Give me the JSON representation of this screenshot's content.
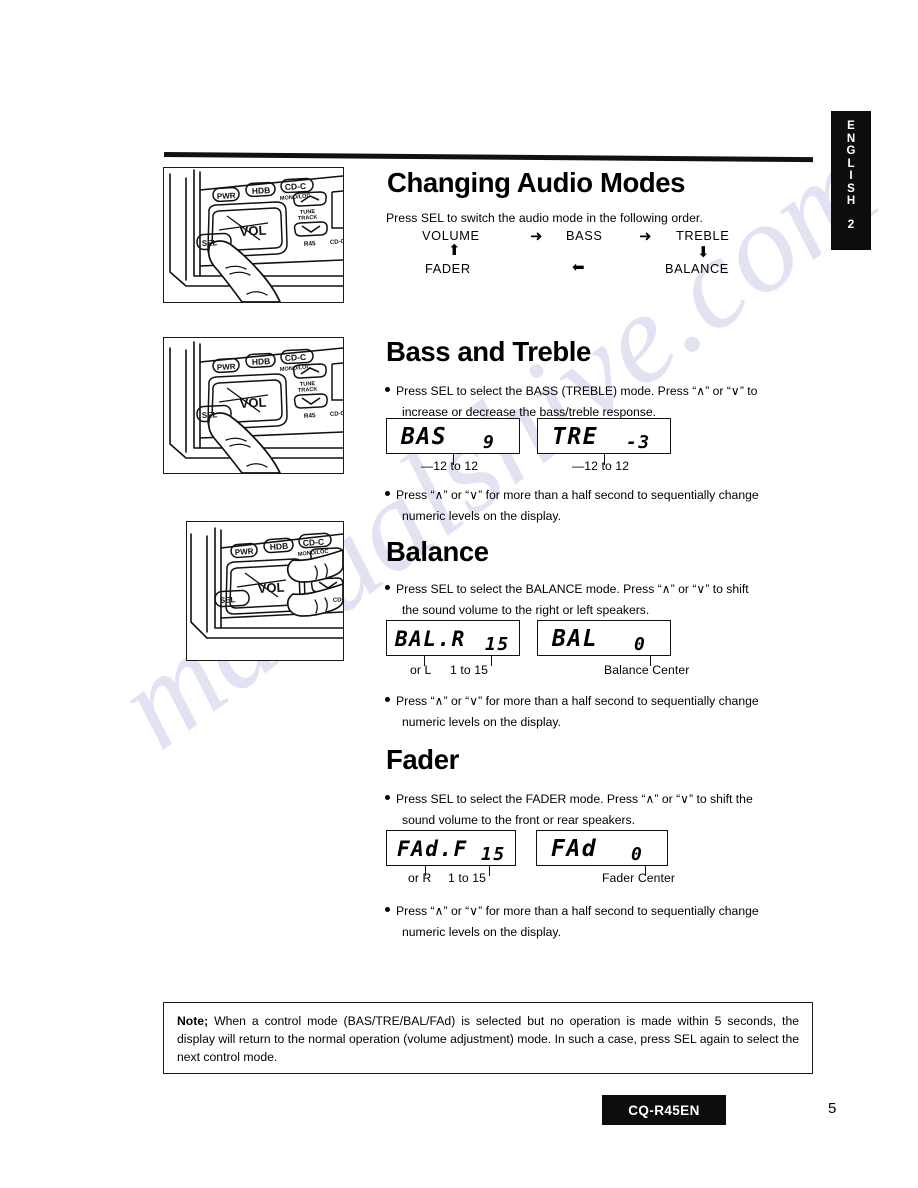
{
  "page": {
    "language_tab": {
      "letters": [
        "E",
        "N",
        "G",
        "L",
        "I",
        "S",
        "H"
      ],
      "number": "2"
    },
    "page_number": "5",
    "model_badge": "CQ-R45EN",
    "watermark": "manualshive.com"
  },
  "sections": [
    {
      "id": "changing-audio-modes",
      "title": "Changing Audio Modes",
      "intro": "Press SEL to switch the audio mode in the following order.",
      "cycle": {
        "nodes": [
          "VOLUME",
          "BASS",
          "TREBLE",
          "BALANCE",
          "FADER"
        ],
        "arrows": [
          "right",
          "right",
          "down",
          "left",
          "up"
        ]
      },
      "illustration": {
        "caption_buttons": [
          "PWR",
          "HDB",
          "CD-C",
          "MONO/LOC",
          "VOL",
          "SEL",
          "TUNE TRACK",
          "R45"
        ]
      }
    },
    {
      "id": "bass-and-treble",
      "title": "Bass and Treble",
      "bullets": [
        {
          "line1": "Press SEL to select the BASS (TREBLE) mode. Press “∧” or “∨” to",
          "line2": "increase or decrease the bass/treble response."
        },
        {
          "line1": "Press “∧” or “∨” for more than a half second to sequentially change",
          "line2": "numeric levels on the display."
        }
      ],
      "displays": [
        {
          "mode": "BAS",
          "value": "9",
          "caption": "—12 to 12"
        },
        {
          "mode": "TRE",
          "value": "-3",
          "caption": "—12 to 12"
        }
      ]
    },
    {
      "id": "balance",
      "title": "Balance",
      "bullets": [
        {
          "line1": "Press SEL to select the BALANCE mode. Press “∧” or “∨” to shift",
          "line2": "the sound volume to the right or left speakers."
        },
        {
          "line1": "Press “∧” or “∨” for more than a half second to sequentially change",
          "line2": "numeric levels on the display."
        }
      ],
      "displays": [
        {
          "mode": "BAL.R",
          "value": "15",
          "caption_left": "or L",
          "caption_right": "1 to 15"
        },
        {
          "mode": "BAL",
          "value": "0",
          "caption": "Balance Center"
        }
      ]
    },
    {
      "id": "fader",
      "title": "Fader",
      "bullets": [
        {
          "line1": "Press SEL to select the FADER mode. Press “∧” or “∨” to shift the",
          "line2": "sound volume to the front or rear speakers."
        },
        {
          "line1": "Press “∧” or “∨” for more than a half second to sequentially change",
          "line2": "numeric levels on the display."
        }
      ],
      "displays": [
        {
          "mode": "FAd.F",
          "value": "15",
          "caption_left": "or R",
          "caption_right": "1 to 15"
        },
        {
          "mode": "FAd",
          "value": "0",
          "caption": "Fader Center"
        }
      ]
    }
  ],
  "note": {
    "label": "Note;",
    "text": " When a control mode (BAS/TRE/BAL/FAd) is selected but no operation is made within 5 seconds, the display will return to the normal operation (volume adjustment) mode. In such a case, press SEL again to select the next control mode."
  }
}
